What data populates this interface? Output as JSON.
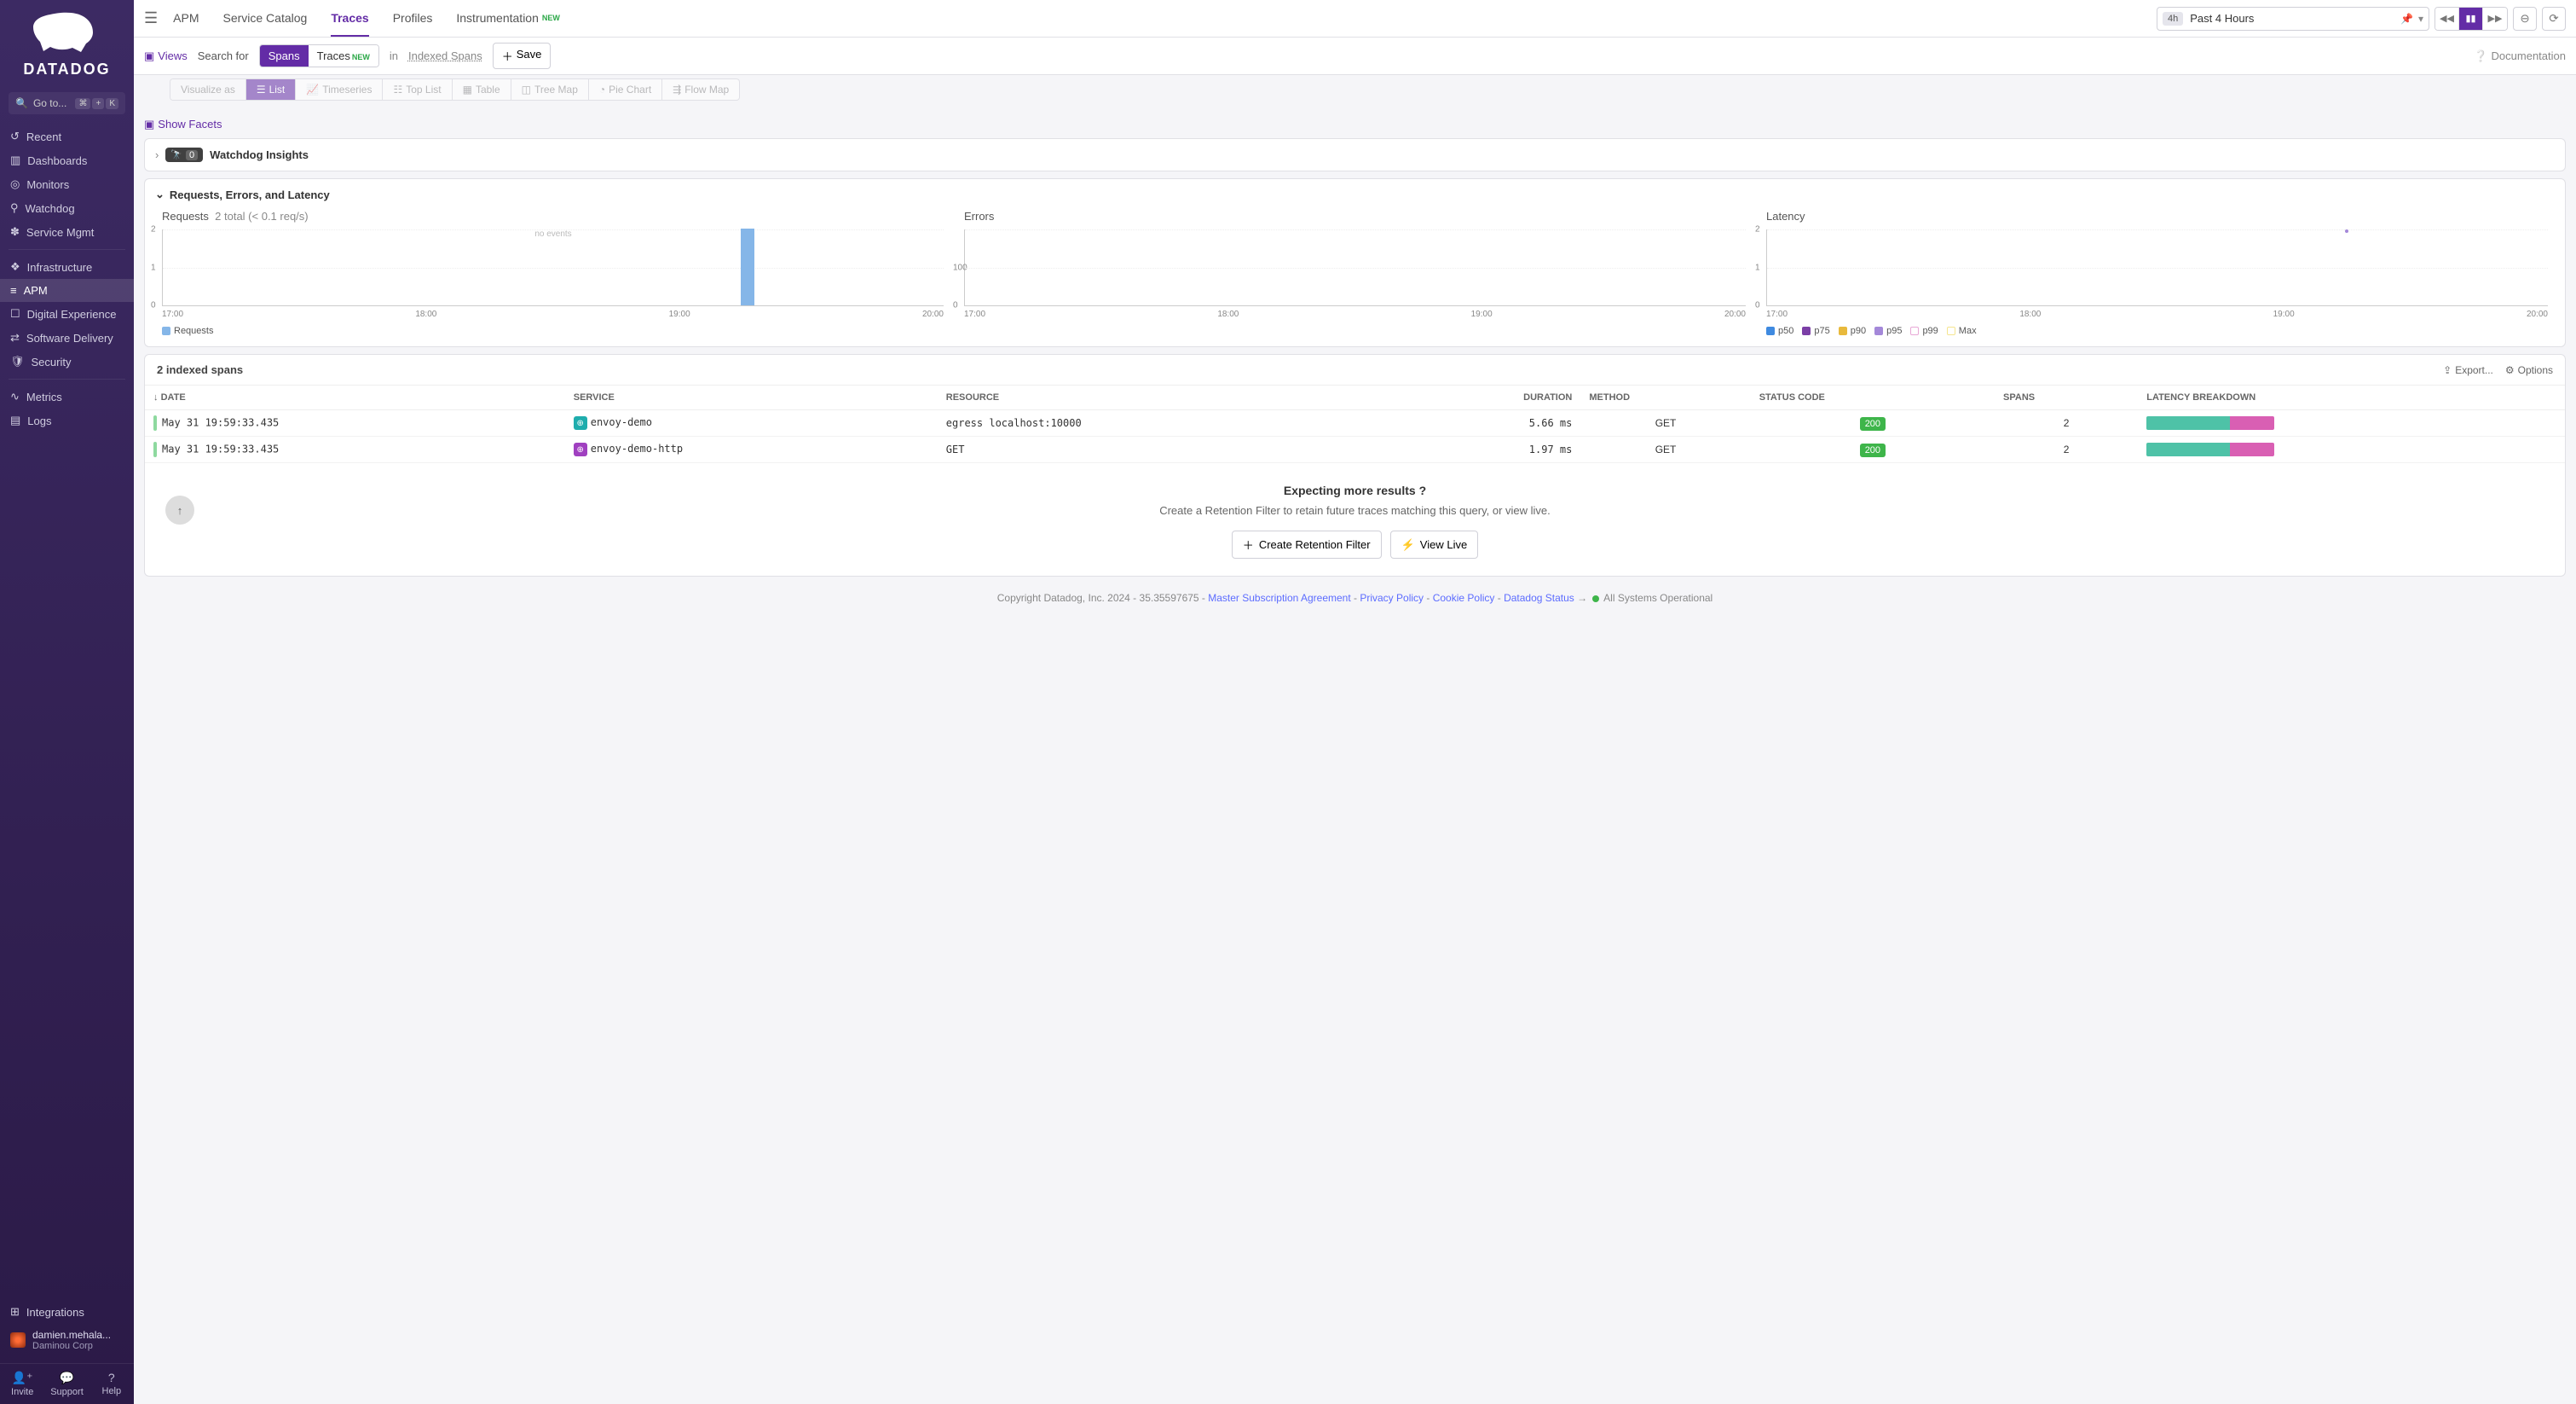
{
  "brand": "DATADOG",
  "search": {
    "placeholder": "Go to...",
    "shortcut_mod": "⌘",
    "shortcut_plus": "+",
    "shortcut_key": "K"
  },
  "sidebar": {
    "items": [
      {
        "label": "Recent",
        "icon": "↺"
      },
      {
        "label": "Dashboards",
        "icon": "▥"
      },
      {
        "label": "Monitors",
        "icon": "◎"
      },
      {
        "label": "Watchdog",
        "icon": "⚲"
      },
      {
        "label": "Service Mgmt",
        "icon": "✽"
      }
    ],
    "items2": [
      {
        "label": "Infrastructure",
        "icon": "❖"
      },
      {
        "label": "APM",
        "icon": "≡",
        "active": true
      },
      {
        "label": "Digital Experience",
        "icon": "☐"
      },
      {
        "label": "Software Delivery",
        "icon": "⇄"
      },
      {
        "label": "Security",
        "icon": "🛡"
      }
    ],
    "items3": [
      {
        "label": "Metrics",
        "icon": "∿"
      },
      {
        "label": "Logs",
        "icon": "▤"
      }
    ],
    "integrations": "Integrations",
    "user_name": "damien.mehala...",
    "user_org": "Daminou Corp",
    "footer": {
      "invite": "Invite",
      "support": "Support",
      "help": "Help"
    }
  },
  "topnav": {
    "tabs": [
      "APM",
      "Service Catalog",
      "Traces",
      "Profiles",
      "Instrumentation"
    ],
    "active": "Traces",
    "badge_tab": "Instrumentation",
    "badge": "NEW",
    "time_preset": "4h",
    "time_label": "Past 4 Hours"
  },
  "subbar": {
    "views": "Views",
    "search_for": "Search for",
    "spans": "Spans",
    "traces": "Traces",
    "traces_badge": "NEW",
    "in": "in",
    "indexed": "Indexed Spans",
    "save": "Save",
    "documentation": "Documentation"
  },
  "viz": {
    "label": "Visualize as",
    "options": [
      "List",
      "Timeseries",
      "Top List",
      "Table",
      "Tree Map",
      "Pie Chart",
      "Flow Map"
    ],
    "active": "List"
  },
  "show_facets": "Show Facets",
  "watchdog": {
    "label": "Watchdog Insights",
    "count": "0"
  },
  "rel": {
    "title": "Requests, Errors, and Latency",
    "requests": {
      "title": "Requests",
      "sub": "2 total (< 0.1 req/s)",
      "noevents": "no events",
      "legend": "Requests"
    },
    "errors": {
      "title": "Errors"
    },
    "latency": {
      "title": "Latency",
      "legend": [
        "p50",
        "p75",
        "p90",
        "p95",
        "p99",
        "Max"
      ]
    },
    "xticks": [
      "17:00",
      "18:00",
      "19:00",
      "20:00"
    ]
  },
  "chart_data": [
    {
      "type": "bar",
      "title": "Requests",
      "categories": [
        "17:00",
        "18:00",
        "19:00",
        "20:00"
      ],
      "values": [
        0,
        0,
        0,
        2
      ],
      "ylim": [
        0,
        2
      ],
      "yticks": [
        0,
        1,
        2
      ],
      "series_name": "Requests"
    },
    {
      "type": "bar",
      "title": "Errors",
      "categories": [
        "17:00",
        "18:00",
        "19:00",
        "20:00"
      ],
      "values": [
        0,
        0,
        0,
        0
      ],
      "ylim": [
        0,
        100
      ],
      "yticks": [
        0,
        100
      ]
    },
    {
      "type": "line",
      "title": "Latency",
      "categories": [
        "17:00",
        "18:00",
        "19:00",
        "20:00"
      ],
      "series": [
        {
          "name": "p50",
          "values": [
            null,
            null,
            null,
            2
          ]
        },
        {
          "name": "p75",
          "values": [
            null,
            null,
            null,
            2
          ]
        },
        {
          "name": "p90",
          "values": [
            null,
            null,
            null,
            2
          ]
        },
        {
          "name": "p95",
          "values": [
            null,
            null,
            null,
            2
          ]
        },
        {
          "name": "p99",
          "values": [
            null,
            null,
            null,
            2
          ]
        },
        {
          "name": "Max",
          "values": [
            null,
            null,
            null,
            2
          ]
        }
      ],
      "ylim": [
        0,
        2
      ],
      "yticks": [
        0,
        1,
        2
      ]
    }
  ],
  "table": {
    "title": "2 indexed spans",
    "export": "Export...",
    "options": "Options",
    "columns": [
      "DATE",
      "SERVICE",
      "RESOURCE",
      "DURATION",
      "METHOD",
      "STATUS CODE",
      "SPANS",
      "LATENCY BREAKDOWN"
    ],
    "rows": [
      {
        "date": "May 31 19:59:33.435",
        "service": "envoy-demo",
        "svc_color": "teal",
        "resource": "egress localhost:10000",
        "duration": "5.66 ms",
        "method": "GET",
        "status": "200",
        "spans": "2",
        "seg1": 65,
        "seg2": 35
      },
      {
        "date": "May 31 19:59:33.435",
        "service": "envoy-demo-http",
        "svc_color": "purple",
        "resource": "GET",
        "duration": "1.97 ms",
        "method": "GET",
        "status": "200",
        "spans": "2",
        "seg1": 65,
        "seg2": 35
      }
    ],
    "empty": {
      "title": "Expecting more results ?",
      "desc": "Create a Retention Filter to retain future traces matching this query, or view live.",
      "create": "Create Retention Filter",
      "viewlive": "View Live"
    }
  },
  "footer": {
    "copyright": "Copyright Datadog, Inc. 2024 - 35.35597675 - ",
    "links": [
      "Master Subscription Agreement",
      "Privacy Policy",
      "Cookie Policy",
      "Datadog Status"
    ],
    "status": "All Systems Operational"
  },
  "colors": {
    "p50": "#3f8ae0",
    "p75": "#7b3fa6",
    "p90": "#e8b93c",
    "p95": "#a488d9",
    "p99": "#e8a8d6",
    "max": "#f5e58f"
  }
}
